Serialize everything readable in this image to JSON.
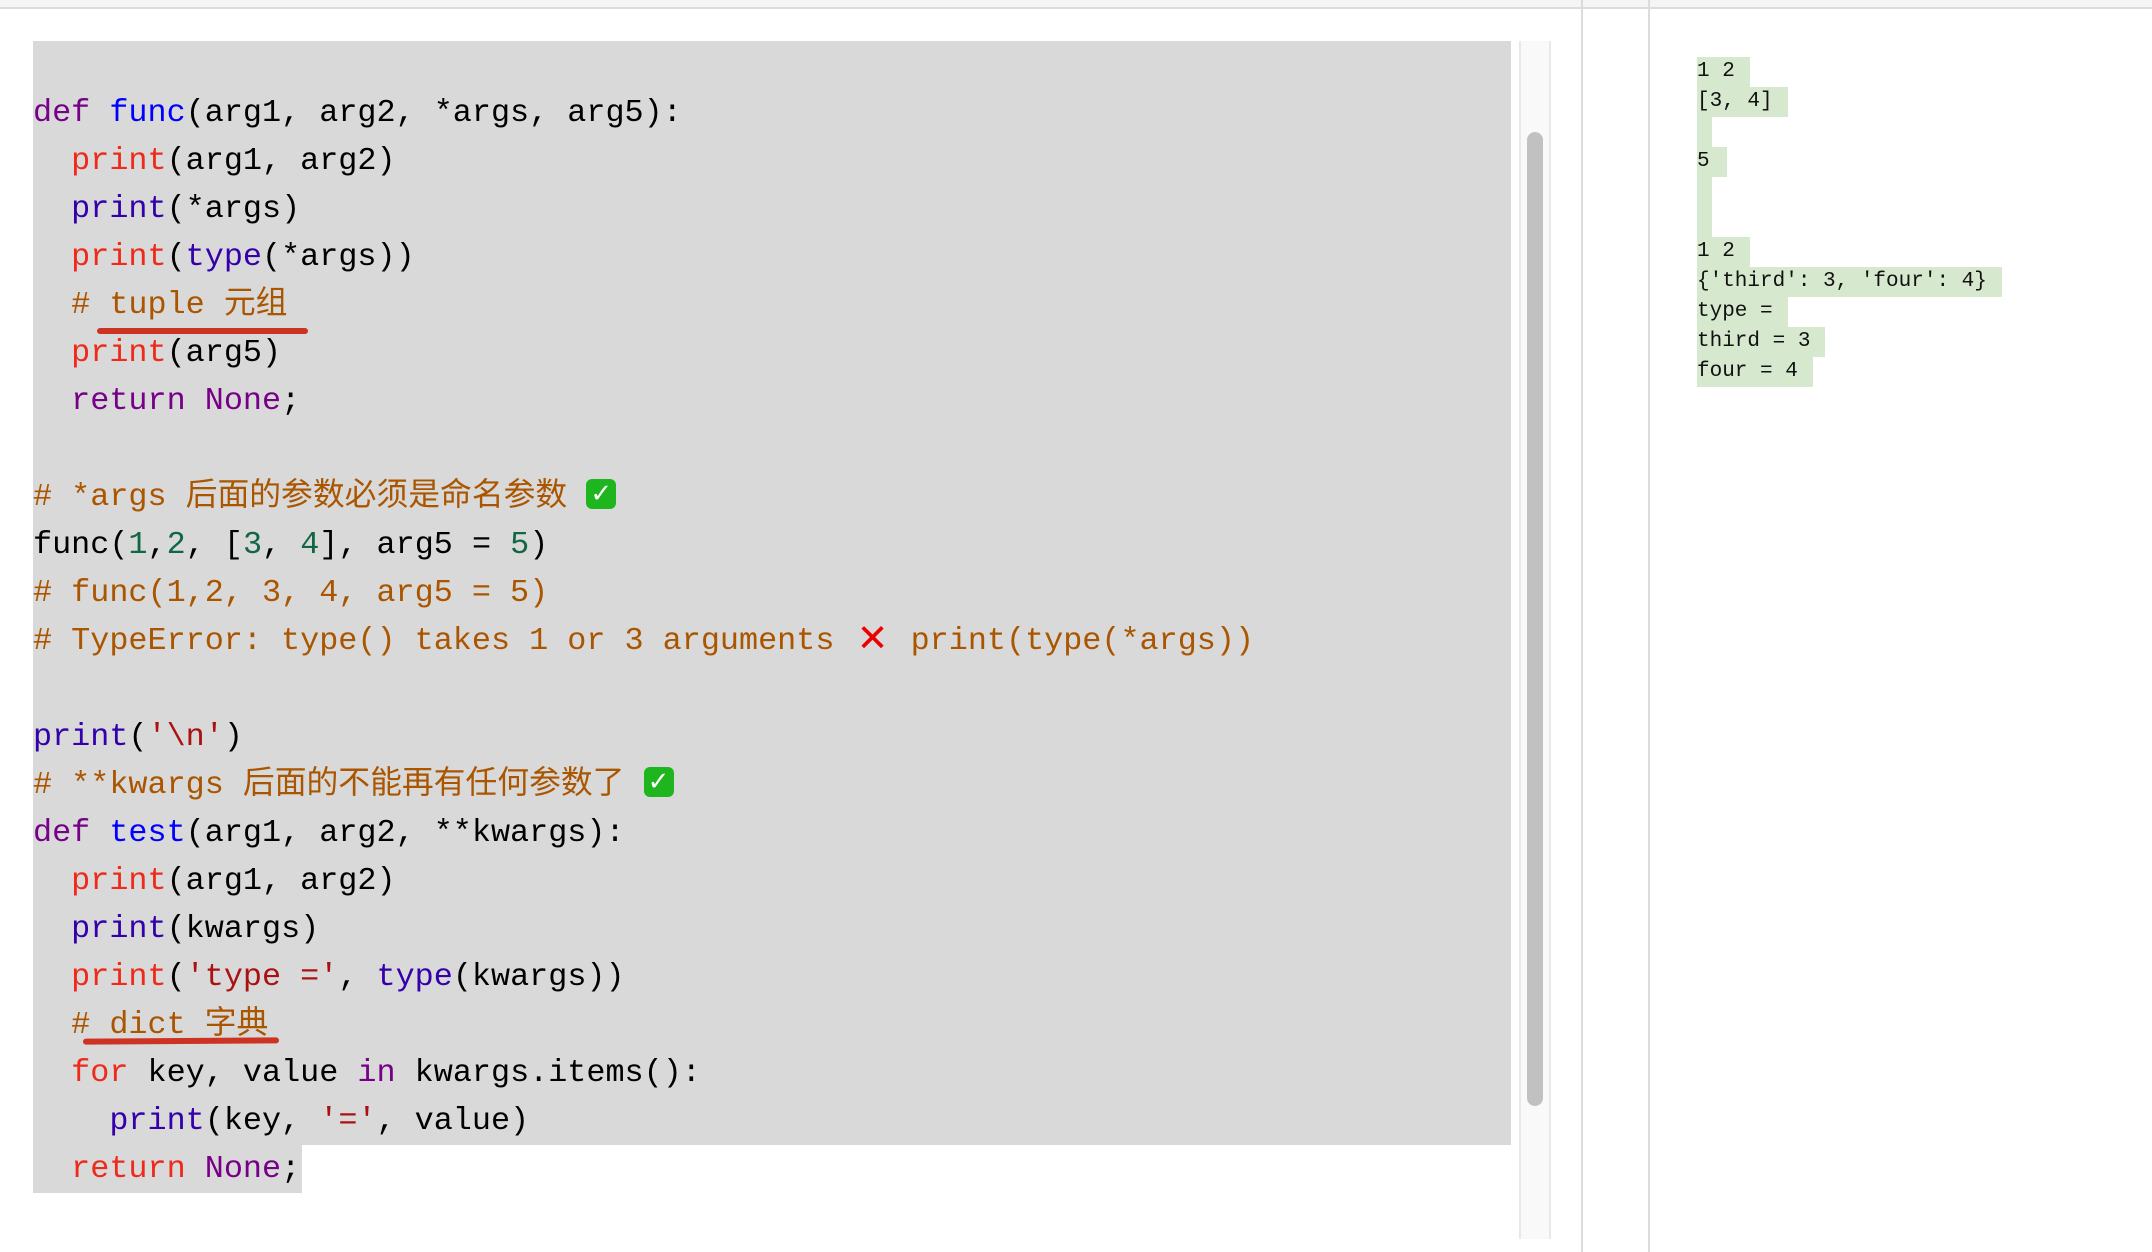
{
  "editor": {
    "lines": [
      {
        "bg": "full",
        "tokens": []
      },
      {
        "bg": "full",
        "tokens": [
          {
            "c": "k-def",
            "t": "def"
          },
          {
            "c": "",
            "t": " "
          },
          {
            "c": "k-fn",
            "t": "func"
          },
          {
            "c": "",
            "t": "(arg1, arg2, *args, arg5):"
          }
        ]
      },
      {
        "bg": "full",
        "tokens": [
          {
            "c": "",
            "t": "  "
          },
          {
            "c": "k-pr",
            "t": "print"
          },
          {
            "c": "",
            "t": "(arg1, arg2)"
          }
        ]
      },
      {
        "bg": "full",
        "tokens": [
          {
            "c": "",
            "t": "  "
          },
          {
            "c": "k-pb",
            "t": "print"
          },
          {
            "c": "",
            "t": "(*args)"
          }
        ]
      },
      {
        "bg": "full",
        "tokens": [
          {
            "c": "",
            "t": "  "
          },
          {
            "c": "k-pr",
            "t": "print"
          },
          {
            "c": "",
            "t": "("
          },
          {
            "c": "k-pb",
            "t": "type"
          },
          {
            "c": "",
            "t": "(*args))"
          }
        ]
      },
      {
        "bg": "full",
        "tokens": [
          {
            "c": "",
            "t": "  "
          },
          {
            "c": "k-cm",
            "t": "# tuple 元组"
          }
        ]
      },
      {
        "bg": "full",
        "tokens": [
          {
            "c": "",
            "t": "  "
          },
          {
            "c": "k-pr",
            "t": "print"
          },
          {
            "c": "",
            "t": "(arg5)"
          }
        ]
      },
      {
        "bg": "full",
        "tokens": [
          {
            "c": "",
            "t": "  "
          },
          {
            "c": "k-kw",
            "t": "return"
          },
          {
            "c": "",
            "t": " "
          },
          {
            "c": "k-kw",
            "t": "None"
          },
          {
            "c": "",
            "t": ";"
          }
        ]
      },
      {
        "bg": "full",
        "tokens": []
      },
      {
        "bg": "full",
        "tokens": [
          {
            "c": "k-cm",
            "t": "# *args 后面的参数必须是命名参数 "
          },
          {
            "c": "emoji-check",
            "t": "✓",
            "icon": "check-mark-icon"
          }
        ]
      },
      {
        "bg": "full",
        "tokens": [
          {
            "c": "",
            "t": "func("
          },
          {
            "c": "k-num",
            "t": "1"
          },
          {
            "c": "",
            "t": ","
          },
          {
            "c": "k-num",
            "t": "2"
          },
          {
            "c": "",
            "t": ", ["
          },
          {
            "c": "k-num",
            "t": "3"
          },
          {
            "c": "",
            "t": ", "
          },
          {
            "c": "k-num",
            "t": "4"
          },
          {
            "c": "",
            "t": "], arg5 = "
          },
          {
            "c": "k-num",
            "t": "5"
          },
          {
            "c": "",
            "t": ")"
          }
        ]
      },
      {
        "bg": "full",
        "tokens": [
          {
            "c": "k-cm",
            "t": "# func(1,2, 3, 4, arg5 = 5)"
          }
        ]
      },
      {
        "bg": "full",
        "tokens": [
          {
            "c": "k-cm",
            "t": "# TypeError: type() takes 1 or 3 arguments "
          },
          {
            "c": "emoji-x",
            "t": "✕",
            "icon": "cross-mark-icon"
          },
          {
            "c": "k-cm",
            "t": " print(type(*args))"
          }
        ]
      },
      {
        "bg": "full",
        "tokens": []
      },
      {
        "bg": "full",
        "tokens": [
          {
            "c": "k-pb",
            "t": "print"
          },
          {
            "c": "",
            "t": "("
          },
          {
            "c": "k-str",
            "t": "'\\n'"
          },
          {
            "c": "",
            "t": ")"
          }
        ]
      },
      {
        "bg": "full",
        "tokens": [
          {
            "c": "k-cm",
            "t": "# **kwargs 后面的不能再有任何参数了 "
          },
          {
            "c": "emoji-check",
            "t": "✓",
            "icon": "check-mark-icon"
          }
        ]
      },
      {
        "bg": "full",
        "tokens": [
          {
            "c": "k-def",
            "t": "def"
          },
          {
            "c": "",
            "t": " "
          },
          {
            "c": "k-fn",
            "t": "test"
          },
          {
            "c": "",
            "t": "(arg1, arg2, **kwargs):"
          }
        ]
      },
      {
        "bg": "full",
        "tokens": [
          {
            "c": "",
            "t": "  "
          },
          {
            "c": "k-pr",
            "t": "print"
          },
          {
            "c": "",
            "t": "(arg1, arg2)"
          }
        ]
      },
      {
        "bg": "full",
        "tokens": [
          {
            "c": "",
            "t": "  "
          },
          {
            "c": "k-pb",
            "t": "print"
          },
          {
            "c": "",
            "t": "(kwargs)"
          }
        ]
      },
      {
        "bg": "full",
        "tokens": [
          {
            "c": "",
            "t": "  "
          },
          {
            "c": "k-pr",
            "t": "print"
          },
          {
            "c": "",
            "t": "("
          },
          {
            "c": "k-str",
            "t": "'type ='"
          },
          {
            "c": "",
            "t": ", "
          },
          {
            "c": "k-pb",
            "t": "type"
          },
          {
            "c": "",
            "t": "(kwargs))"
          }
        ]
      },
      {
        "bg": "full",
        "tokens": [
          {
            "c": "",
            "t": "  "
          },
          {
            "c": "k-cm",
            "t": "# dict 字典"
          }
        ]
      },
      {
        "bg": "full",
        "tokens": [
          {
            "c": "",
            "t": "  "
          },
          {
            "c": "k-for",
            "t": "for"
          },
          {
            "c": "",
            "t": " key, value "
          },
          {
            "c": "k-kw",
            "t": "in"
          },
          {
            "c": "",
            "t": " kwargs.items():"
          }
        ]
      },
      {
        "bg": "full",
        "tokens": [
          {
            "c": "",
            "t": "    "
          },
          {
            "c": "k-pb",
            "t": "print"
          },
          {
            "c": "",
            "t": "(key, "
          },
          {
            "c": "k-str",
            "t": "'='"
          },
          {
            "c": "",
            "t": ", value)"
          }
        ]
      },
      {
        "bg": "partial",
        "tokens": [
          {
            "c": "",
            "t": "  "
          },
          {
            "c": "k-for",
            "t": "return"
          },
          {
            "c": "",
            "t": " "
          },
          {
            "c": "k-kw",
            "t": "None"
          },
          {
            "c": "",
            "t": ";"
          }
        ]
      }
    ],
    "annotations": [
      {
        "name": "underline-tuple-annotation",
        "line": 5
      },
      {
        "name": "underline-dict-annotation",
        "line": 20
      }
    ]
  },
  "output": {
    "lines": [
      "1 2",
      "[3, 4]",
      "",
      "5",
      "",
      "",
      "1 2",
      "{'third': 3, 'four': 4}",
      "type =",
      "third = 3",
      "four = 4"
    ]
  },
  "colors": {
    "code_bg": "#d9d9d9",
    "output_bg": "#d6e8cd",
    "annotation": "#cc3322",
    "comment": "#aa5500",
    "string": "#aa1111",
    "number": "#116644",
    "keyword": "#770088",
    "function": "#0000ff"
  }
}
